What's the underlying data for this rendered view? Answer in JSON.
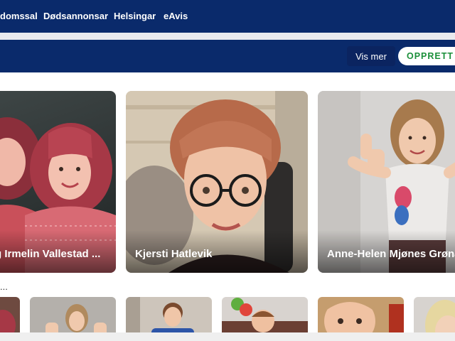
{
  "topnav": {
    "items": [
      {
        "label": "domssal"
      },
      {
        "label": "Dødsannonsar"
      },
      {
        "label": "Helsingar"
      },
      {
        "label": "eAvis"
      }
    ]
  },
  "banner": {
    "vis_mer": "Vis mer",
    "opprett": "OPPRETT I"
  },
  "cards": [
    {
      "name": "g Irmelin Vallestad ..."
    },
    {
      "name": "Kjersti Hatlevik"
    },
    {
      "name": "Anne-Helen Mjønes Grøna"
    }
  ],
  "more_ellipsis": "..."
}
